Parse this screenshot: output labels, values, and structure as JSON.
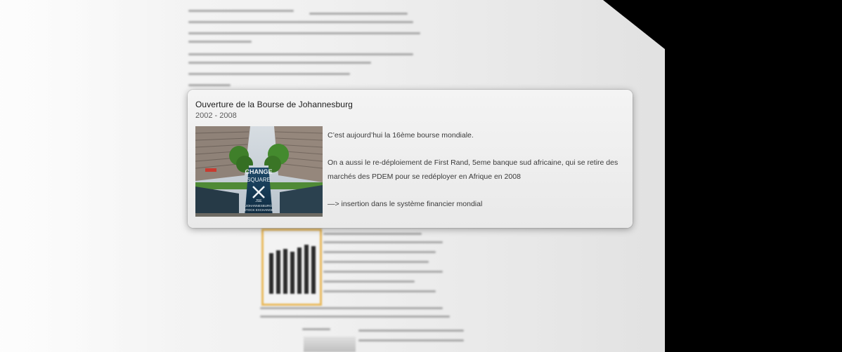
{
  "card": {
    "title": "Ouverture de la Bourse de Johannesburg",
    "subtitle": "2002 - 2008",
    "paragraphs": [
      "C’est aujourd’hui la 16ème bourse mondiale.",
      "On a aussi le re-déploiement de First Rand, 5eme banque sud africaine, qui se retire des marchés des PDEM pour se redéployer en Afrique en 2008",
      "—> insertion dans le système financier mondial"
    ],
    "photo": {
      "icon": "johannesburg-stock-exchange-photo",
      "sign_text": [
        "CHANGE",
        "SQUARE",
        "JSE",
        "JOHANNESBURG",
        "STOCK EXCHANGE"
      ]
    }
  },
  "colors": {
    "card_bg": "#ececec",
    "page_bg": "#f1f1f1",
    "chart_border": "#e8b85a",
    "backdrop": "#000000"
  }
}
